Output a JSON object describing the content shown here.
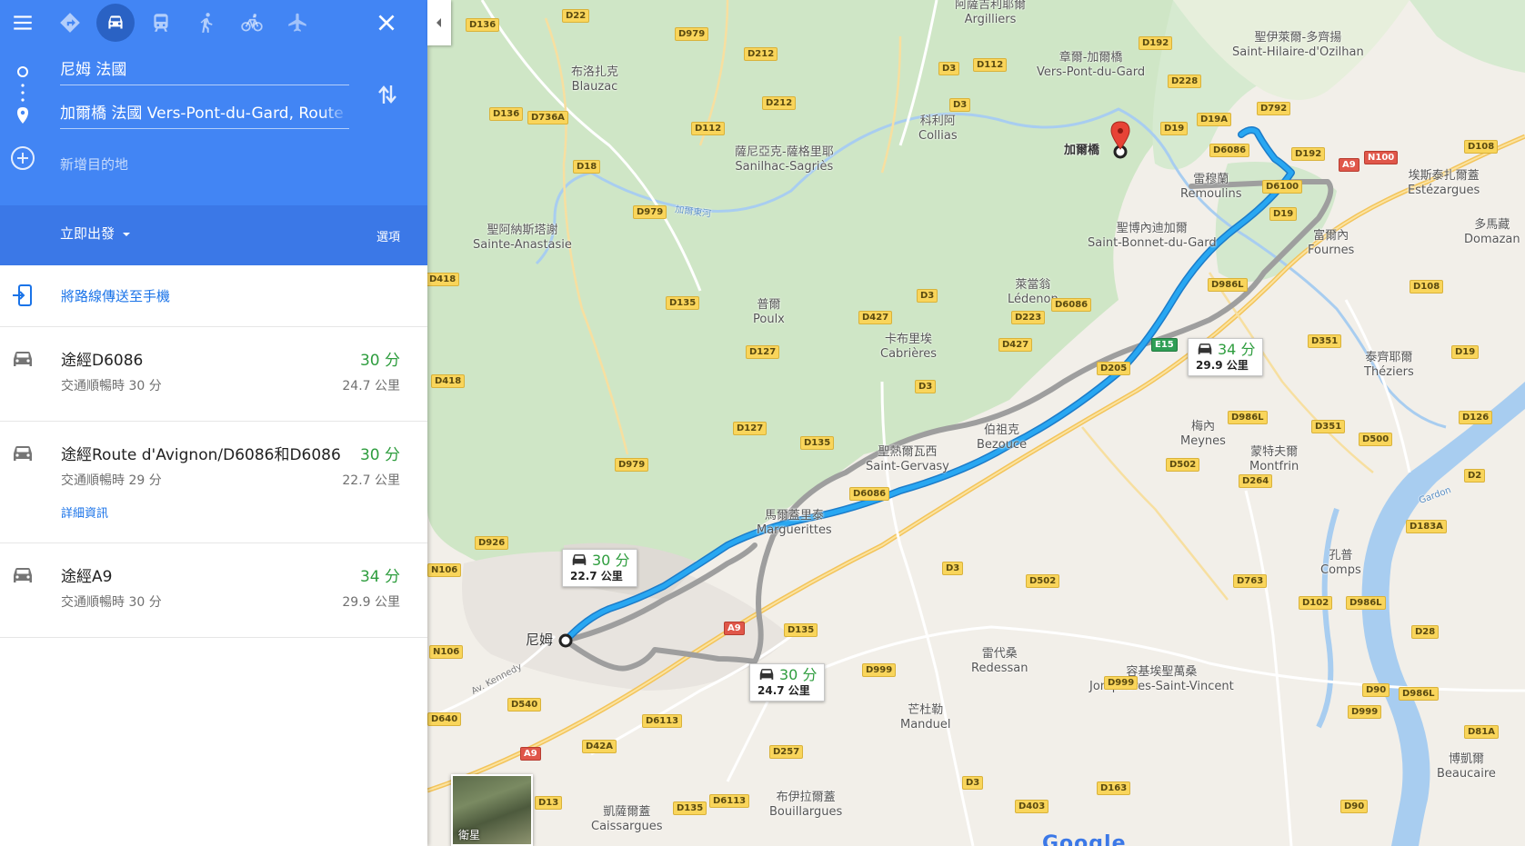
{
  "header": {
    "origin": "尼姆 法國",
    "destination": "加爾橋 法國 Vers-Pont-du-Gard, Route d",
    "add_destination": "新增目的地",
    "depart": "立即出發",
    "options": "選項"
  },
  "send_to_phone": "將路線傳送至手機",
  "routes": [
    {
      "name": "途經D6086",
      "time": "30 分",
      "traffic": "交通順暢時 30 分",
      "distance": "24.7 公里",
      "details": ""
    },
    {
      "name": "途經Route d'Avignon/D6086和D6086",
      "time": "30 分",
      "traffic": "交通順暢時 29 分",
      "distance": "22.7 公里",
      "details": "詳細資訊"
    },
    {
      "name": "途經A9",
      "time": "34 分",
      "traffic": "交通順暢時 30 分",
      "distance": "29.9 公里",
      "details": ""
    }
  ],
  "map": {
    "places": [
      "阿薩吉利耶爾",
      "Argilliers",
      "章爾-加爾橋",
      "Vers-Pont-du-Gard",
      "聖伊萊爾-多齊揚",
      "Saint-Hilaire-d'Ozilhan",
      "布洛扎克",
      "Blauzac",
      "科利阿",
      "Collias",
      "薩尼亞克-薩格里耶",
      "Sanilhac-Sagriès",
      "加爾橋",
      "雷穆蘭",
      "Remoulins",
      "埃斯泰扎爾蓋",
      "Estézargues",
      "多馬藏",
      "Domazan",
      "聖博內迪加爾",
      "Saint-Bonnet-du-Gard",
      "富爾內",
      "Fournes",
      "聖阿納斯塔謝",
      "Sainte-Anastasie",
      "普爾",
      "Poulx",
      "萊當翁",
      "Lédenon",
      "卡布里埃",
      "Cabrières",
      "泰齊耶爾",
      "Théziers",
      "梅內",
      "Meynes",
      "伯祖克",
      "Bezouce",
      "聖熱爾瓦西",
      "Saint-Gervasy",
      "蒙特夫爾",
      "Montfrin",
      "馬爾蓋里泰",
      "Marguerittes",
      "孔普",
      "Comps",
      "尼姆",
      "雷代桑",
      "Redessan",
      "容基埃聖萬桑",
      "Jonquières-Saint-Vincent",
      "芒杜勒",
      "Manduel",
      "博凱爾",
      "Beaucaire",
      "布伊拉爾蓋",
      "Bouillargues",
      "凱薩爾蓋",
      "Caissargues",
      "加爾東河",
      "Av. Kennedy",
      "Gardon"
    ],
    "roads": [
      "D22",
      "D136",
      "D979",
      "D212",
      "D3",
      "D112",
      "D192",
      "D228",
      "D792",
      "D136",
      "D736A",
      "D212",
      "D112",
      "D3",
      "D19",
      "D19A",
      "D6086",
      "D192",
      "N100",
      "A9",
      "D108",
      "D18",
      "D979",
      "D6100",
      "D19",
      "D418",
      "D135",
      "D427",
      "D3",
      "D986L",
      "D108",
      "D223",
      "D6086",
      "D427",
      "E15",
      "D205",
      "D351",
      "D19",
      "D418",
      "D127",
      "D3",
      "D986L",
      "D351",
      "D126",
      "D127",
      "D135",
      "D500",
      "D979",
      "D502",
      "D264",
      "D2",
      "D6086",
      "D183A",
      "D926",
      "D3",
      "D502",
      "D763",
      "D102",
      "D986L",
      "N106",
      "D135",
      "A9",
      "D28",
      "N106",
      "D999",
      "D999",
      "D90",
      "D986L",
      "D540",
      "D6113",
      "D999",
      "D81A",
      "D640",
      "D42A",
      "D257",
      "A9",
      "D3",
      "D163",
      "D403",
      "D13",
      "D135",
      "D6113",
      "D90"
    ],
    "bubbles": [
      {
        "time": "30 分",
        "distance": "22.7 公里"
      },
      {
        "time": "30 分",
        "distance": "24.7 公里"
      },
      {
        "time": "34 分",
        "distance": "29.9 公里"
      }
    ],
    "satellite": "衛星",
    "logo": "Google"
  },
  "colors": {
    "primary": "#4285f4",
    "route_main": "#1da1f2",
    "route_alt": "#9e9e9e",
    "time_green": "#2e9d3e"
  },
  "icons": [
    "menu-icon",
    "directions-icon",
    "car-icon",
    "transit-icon",
    "walk-icon",
    "bike-icon",
    "flight-icon",
    "close-icon",
    "swap-icon",
    "add-icon",
    "send-to-phone-icon",
    "dropdown-arrow-icon",
    "collapse-arrow-icon",
    "destination-pin-icon"
  ]
}
